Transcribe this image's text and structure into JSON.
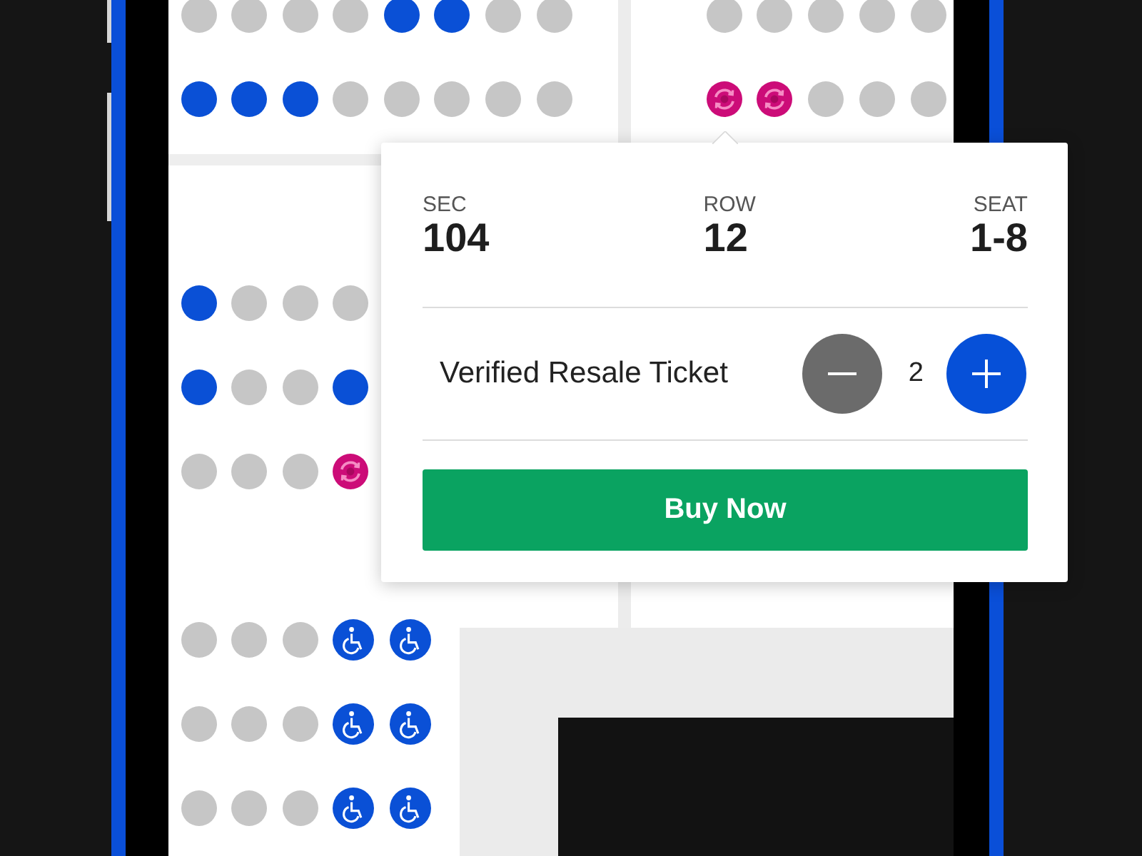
{
  "seat_map": {
    "sections": [
      {
        "rows": [
          {
            "seats": [
              {
                "kind": "unavailable"
              },
              {
                "kind": "unavailable"
              },
              {
                "kind": "unavailable"
              },
              {
                "kind": "unavailable"
              },
              {
                "kind": "available"
              },
              {
                "kind": "available"
              },
              {
                "kind": "unavailable"
              },
              {
                "kind": "unavailable"
              }
            ]
          },
          {
            "seats": [
              {
                "kind": "available"
              },
              {
                "kind": "available"
              },
              {
                "kind": "available"
              },
              {
                "kind": "unavailable"
              },
              {
                "kind": "unavailable"
              },
              {
                "kind": "unavailable"
              },
              {
                "kind": "unavailable"
              },
              {
                "kind": "unavailable"
              }
            ]
          }
        ]
      },
      {
        "rows": [
          {
            "seats": [
              {
                "kind": "unavailable"
              },
              {
                "kind": "unavailable"
              },
              {
                "kind": "unavailable"
              },
              {
                "kind": "unavailable"
              },
              {
                "kind": "unavailable"
              }
            ]
          },
          {
            "seats": [
              {
                "kind": "resale"
              },
              {
                "kind": "resale"
              },
              {
                "kind": "unavailable"
              },
              {
                "kind": "unavailable"
              },
              {
                "kind": "unavailable"
              }
            ]
          }
        ]
      },
      {
        "rows": [
          {
            "seats": [
              {
                "kind": "available"
              },
              {
                "kind": "unavailable"
              },
              {
                "kind": "unavailable"
              },
              {
                "kind": "unavailable"
              }
            ]
          },
          {
            "seats": [
              {
                "kind": "available"
              },
              {
                "kind": "unavailable"
              },
              {
                "kind": "unavailable"
              },
              {
                "kind": "available"
              }
            ]
          },
          {
            "seats": [
              {
                "kind": "unavailable"
              },
              {
                "kind": "unavailable"
              },
              {
                "kind": "unavailable"
              },
              {
                "kind": "resale"
              }
            ]
          }
        ]
      },
      {
        "rows": [
          {
            "seats": [
              {
                "kind": "unavailable"
              },
              {
                "kind": "unavailable"
              },
              {
                "kind": "unavailable"
              },
              {
                "kind": "accessible"
              },
              {
                "kind": "accessible"
              }
            ]
          },
          {
            "seats": [
              {
                "kind": "unavailable"
              },
              {
                "kind": "unavailable"
              },
              {
                "kind": "unavailable"
              },
              {
                "kind": "accessible"
              },
              {
                "kind": "accessible"
              }
            ]
          },
          {
            "seats": [
              {
                "kind": "unavailable"
              },
              {
                "kind": "unavailable"
              },
              {
                "kind": "unavailable"
              },
              {
                "kind": "accessible"
              },
              {
                "kind": "accessible"
              }
            ]
          }
        ]
      }
    ]
  },
  "seat_popup": {
    "details": [
      {
        "label": "SEC",
        "value": "104"
      },
      {
        "label": "ROW",
        "value": "12"
      },
      {
        "label": "SEAT",
        "value": "1-8"
      }
    ],
    "ticket": {
      "type": "Verified Resale Ticket",
      "quantity": "2"
    },
    "buy_button": "Buy Now"
  }
}
